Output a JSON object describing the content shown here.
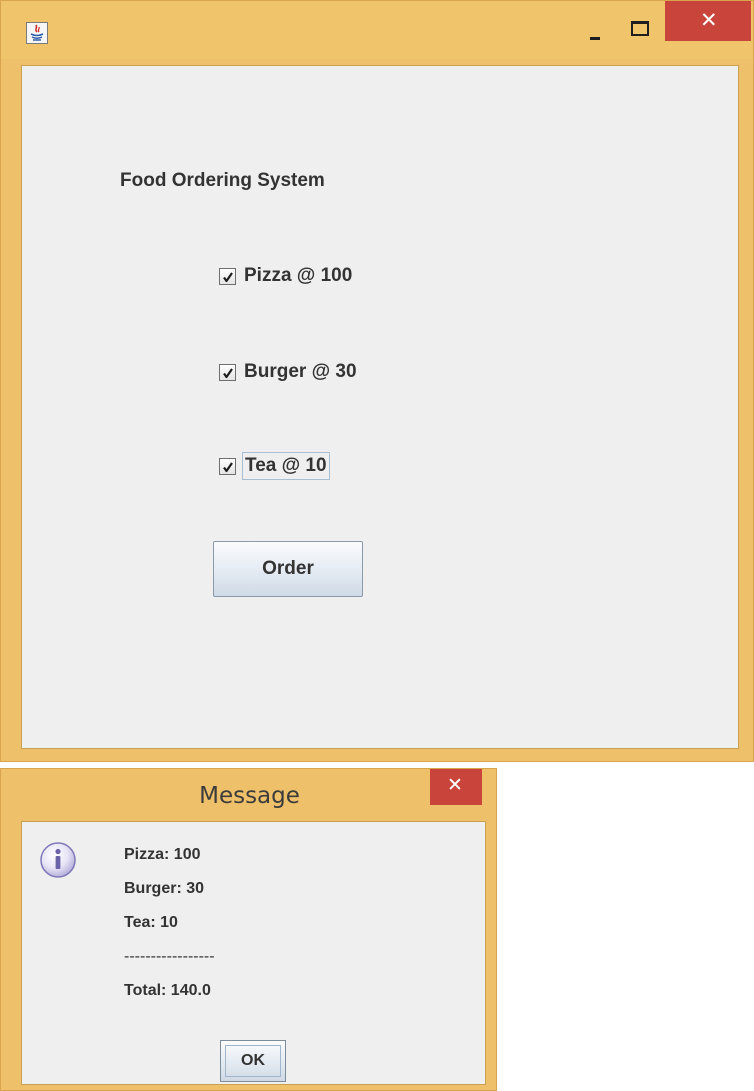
{
  "main_window": {
    "heading": "Food Ordering System",
    "items": [
      {
        "label": "Pizza @ 100",
        "checked": true
      },
      {
        "label": "Burger @ 30",
        "checked": true
      },
      {
        "label": "Tea @ 10",
        "checked": true
      }
    ],
    "order_button_label": "Order",
    "controls": {
      "close_glyph": "✕"
    }
  },
  "dialog": {
    "title": "Message",
    "close_glyph": "✕",
    "lines": [
      "Pizza: 100",
      "Burger: 30",
      "Tea: 10",
      "-----------------",
      "Total: 140.0"
    ],
    "ok_label": "OK"
  },
  "icons": {
    "app": "java-app-icon",
    "minimize": "minimize-icon",
    "maximize": "maximize-icon",
    "close": "close-icon",
    "checkmark": "check-icon",
    "info": "info-icon"
  },
  "colors": {
    "window_frame": "#f0c46a",
    "close_button": "#c9453b",
    "content_background": "#efefef",
    "text": "#333333"
  }
}
